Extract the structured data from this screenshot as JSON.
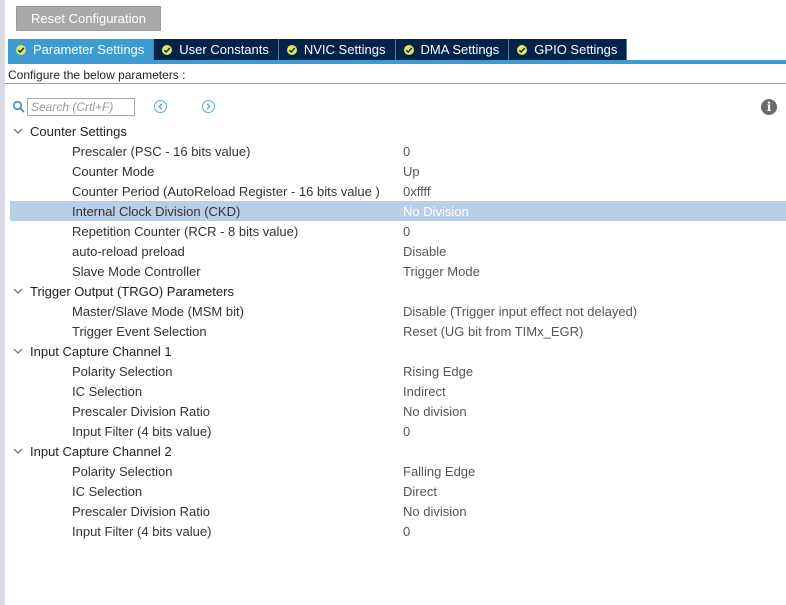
{
  "toolbar": {
    "reset_label": "Reset Configuration"
  },
  "tabs": [
    {
      "label": "Parameter Settings",
      "active": true
    },
    {
      "label": "User Constants",
      "active": false
    },
    {
      "label": "NVIC Settings",
      "active": false
    },
    {
      "label": "DMA Settings",
      "active": false
    },
    {
      "label": "GPIO Settings",
      "active": false
    }
  ],
  "configure_text": "Configure the below parameters :",
  "search": {
    "placeholder": "Search (Crtl+F)"
  },
  "groups": [
    {
      "label": "Counter Settings",
      "params": [
        {
          "label": "Prescaler (PSC - 16 bits value)",
          "value": "0"
        },
        {
          "label": "Counter Mode",
          "value": "Up"
        },
        {
          "label": "Counter Period (AutoReload Register - 16 bits value )",
          "value": "0xffff"
        },
        {
          "label": "Internal Clock Division (CKD)",
          "value": "No Division",
          "selected": true
        },
        {
          "label": "Repetition Counter (RCR - 8 bits value)",
          "value": "0"
        },
        {
          "label": "auto-reload preload",
          "value": "Disable"
        },
        {
          "label": "Slave Mode Controller",
          "value": "Trigger Mode"
        }
      ]
    },
    {
      "label": "Trigger Output (TRGO) Parameters",
      "params": [
        {
          "label": "Master/Slave Mode (MSM bit)",
          "value": "Disable (Trigger input effect not delayed)"
        },
        {
          "label": "Trigger Event Selection",
          "value": "Reset (UG bit from TIMx_EGR)"
        }
      ]
    },
    {
      "label": "Input Capture Channel 1",
      "params": [
        {
          "label": "Polarity Selection",
          "value": "Rising Edge"
        },
        {
          "label": "IC Selection",
          "value": "Indirect"
        },
        {
          "label": "Prescaler Division Ratio",
          "value": "No division"
        },
        {
          "label": "Input Filter (4 bits value)",
          "value": "0"
        }
      ]
    },
    {
      "label": "Input Capture Channel 2",
      "params": [
        {
          "label": "Polarity Selection",
          "value": "Falling Edge"
        },
        {
          "label": "IC Selection",
          "value": "Direct"
        },
        {
          "label": "Prescaler Division Ratio",
          "value": "No division"
        },
        {
          "label": "Input Filter (4 bits value)",
          "value": "0"
        }
      ]
    }
  ],
  "colors": {
    "tab_bg": "#03234b",
    "tab_active": "#3c9bd1",
    "tab_check": "#e3e55e",
    "selected_row": "#b8cfe6",
    "reset_button": "#a9a9a9"
  },
  "icons": {
    "search": "search-icon",
    "prev": "arrow-left-circle-icon",
    "next": "arrow-right-circle-icon",
    "info": "info-icon",
    "expand": "chevron-down-icon",
    "tab_check": "check-circle-icon"
  }
}
